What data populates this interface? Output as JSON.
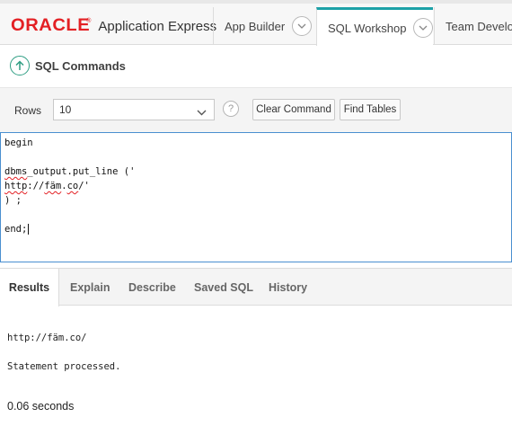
{
  "header": {
    "logo_oracle": "ORACLE",
    "logo_mark": "®",
    "logo_product": "Application Express",
    "tabs": [
      {
        "label": "App Builder"
      },
      {
        "label": "SQL Workshop"
      },
      {
        "label": "Team Develop"
      }
    ]
  },
  "page": {
    "title": "SQL Commands"
  },
  "toolbar": {
    "rows_label": "Rows",
    "rows_value": "10",
    "help_glyph": "?",
    "clear_label": "Clear Command",
    "find_label": "Find Tables"
  },
  "editor": {
    "lines": [
      "begin",
      "",
      "dbms_output.put_line ('",
      "http://fäm.co/'",
      ") ;",
      "",
      "end;"
    ],
    "squiggle_words": {
      "l2": "dbms",
      "l3a": "http",
      "l3b": "fäm"
    }
  },
  "results": {
    "tabs": [
      {
        "label": "Results"
      },
      {
        "label": "Explain"
      },
      {
        "label": "Describe"
      },
      {
        "label": "Saved SQL"
      },
      {
        "label": "History"
      }
    ],
    "output_line": "http://fäm.co/",
    "status": "Statement processed.",
    "timing": "0.06 seconds"
  },
  "colors": {
    "brand_red": "#e32024",
    "active_tab_accent": "#1da1a7",
    "title_icon": "#2f9e83",
    "editor_border": "#4a8fd0"
  },
  "icons": {
    "title": "circle-up-arrow-icon",
    "tab_dropdown": "chevron-down-icon",
    "help": "help-icon"
  }
}
